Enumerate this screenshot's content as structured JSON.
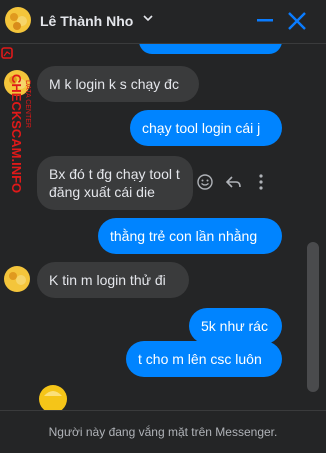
{
  "header": {
    "name": "Lê Thành Nho"
  },
  "messages": [
    {
      "side": "out",
      "text": ""
    },
    {
      "side": "in",
      "text": "M k login k s chạy đc"
    },
    {
      "side": "out",
      "text": "chạy tool login cái j"
    },
    {
      "side": "in",
      "text": "Bx đó t đg chạy tool t đăng xuất cái die"
    },
    {
      "side": "out",
      "text": "thằng trẻ con lần nhằng"
    },
    {
      "side": "in",
      "text": "K tin m login thử đi"
    },
    {
      "side": "out",
      "text": "5k như rác"
    },
    {
      "side": "out",
      "text": "t cho m lên csc luôn"
    }
  ],
  "footer": {
    "status": "Người này đang vắng mặt trên Messenger."
  },
  "watermark": {
    "line1": "CHECKSCAM.INFO",
    "line2": "DATA CENTER"
  },
  "colors": {
    "background": "#242526",
    "outgoing": "#0084ff",
    "incoming": "#3a3b3c",
    "accent": "#0a7cff"
  },
  "icons": [
    "avatar",
    "chevron-down-icon",
    "minimize-icon",
    "close-icon",
    "emoji-icon",
    "reply-icon",
    "more-icon",
    "wave-emoji"
  ]
}
